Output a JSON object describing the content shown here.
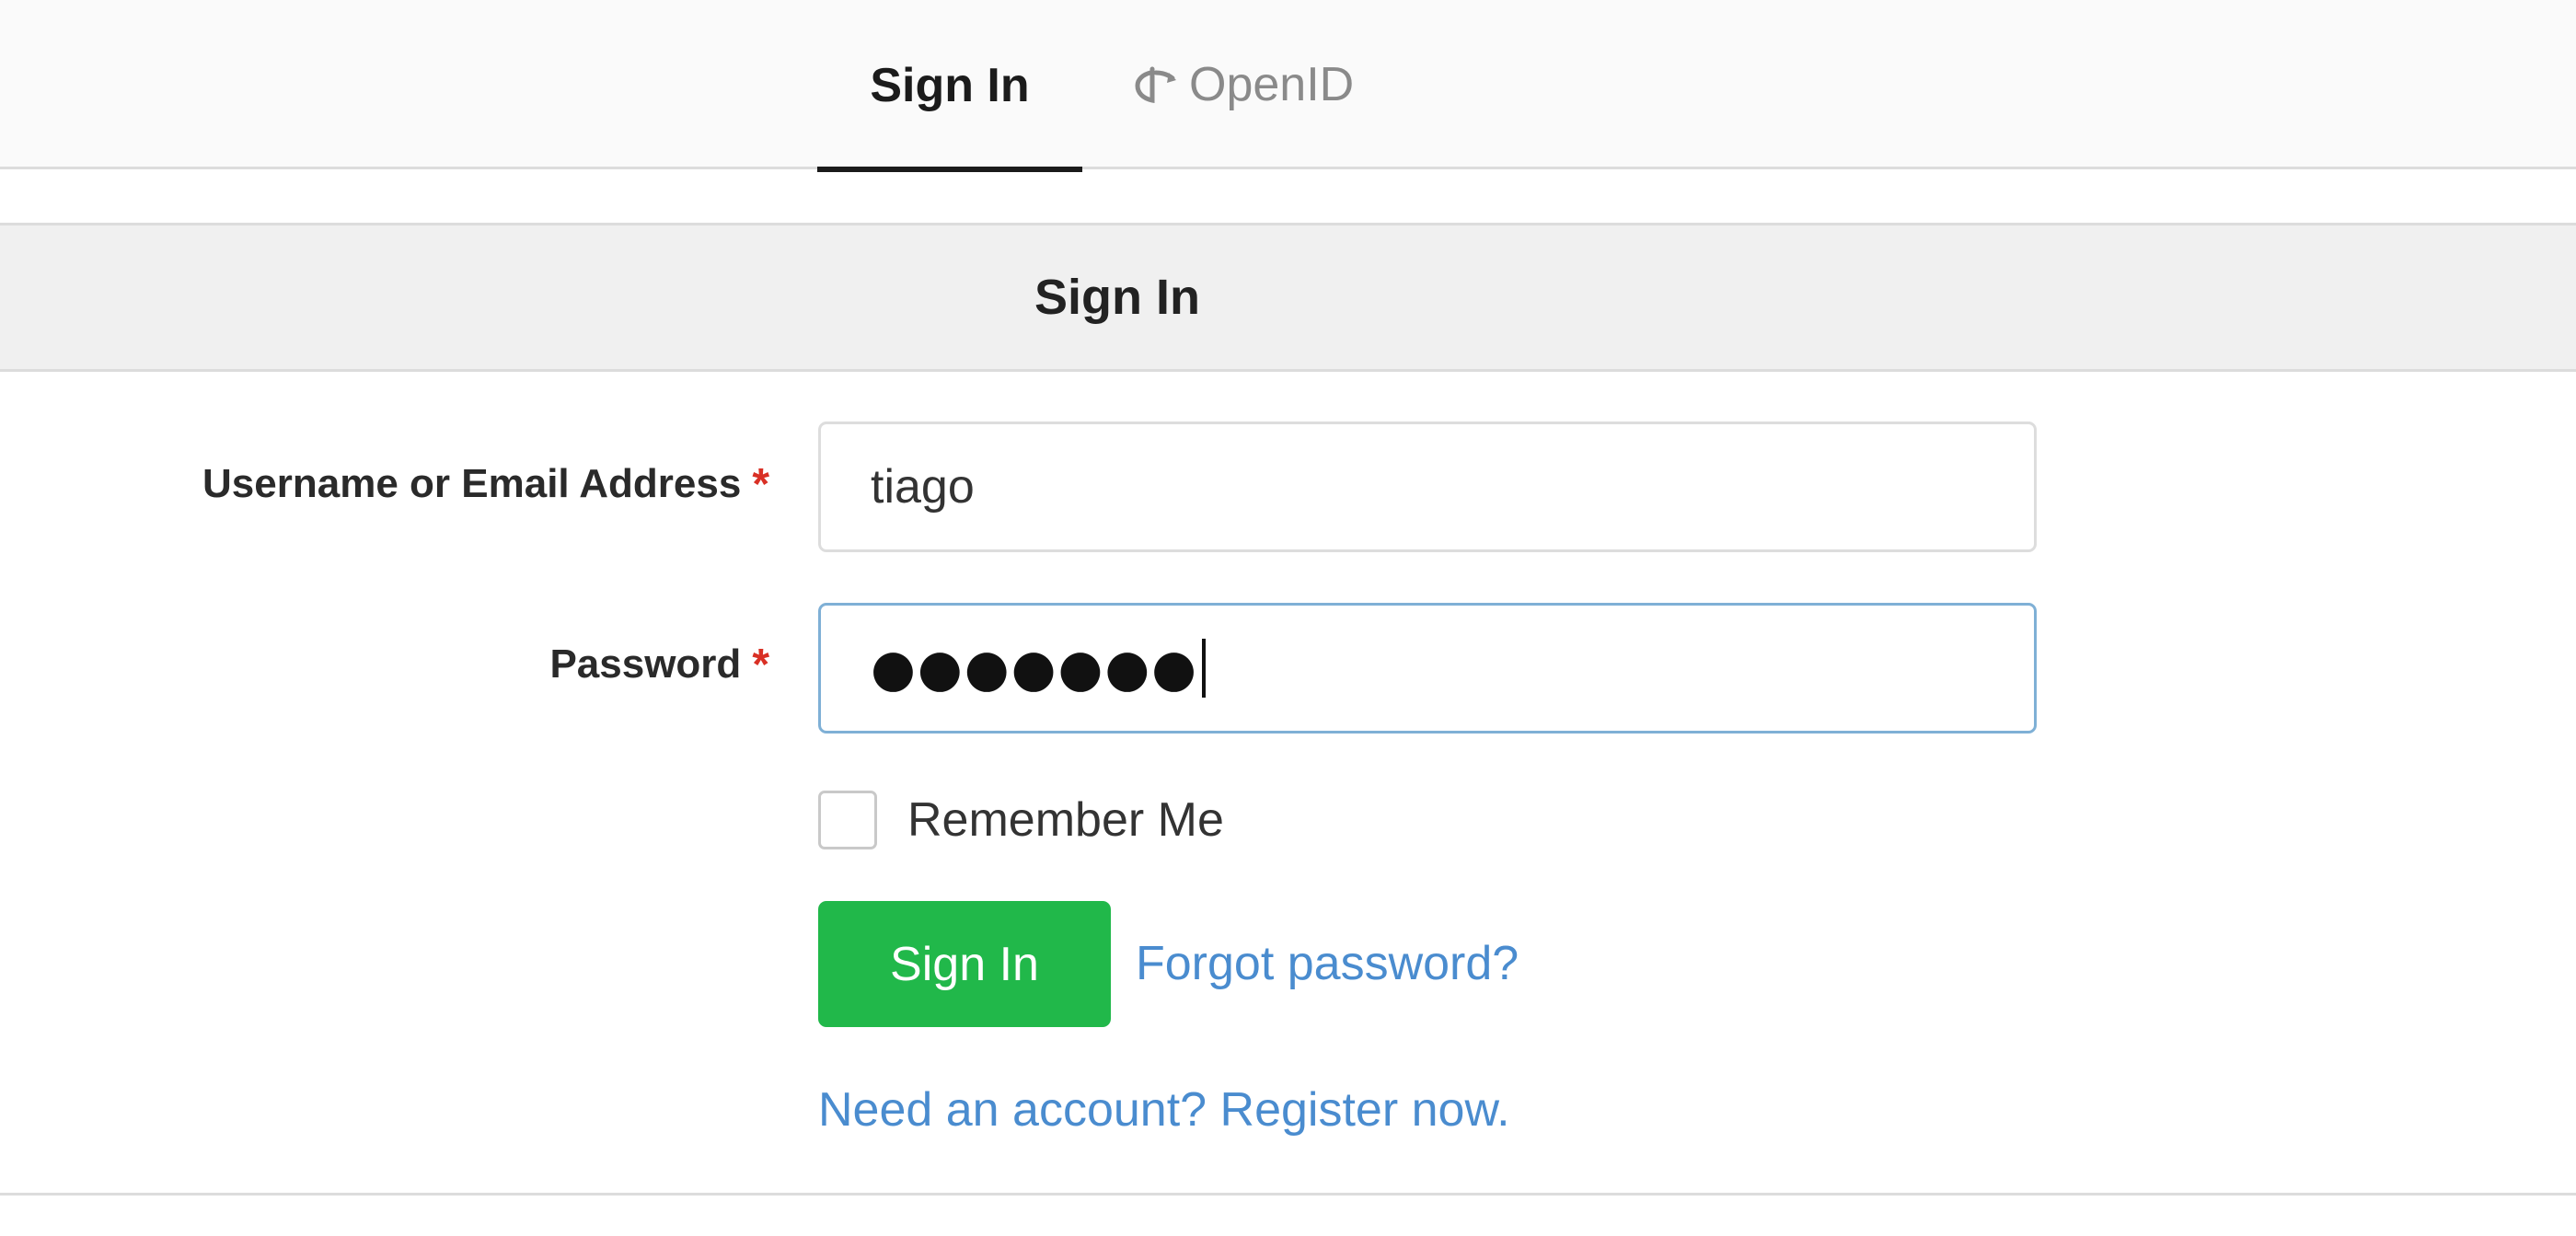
{
  "tabs": {
    "signin_label": "Sign In",
    "openid_label": "OpenID",
    "active": "Sign In"
  },
  "header": {
    "title": "Sign In"
  },
  "form": {
    "username_label": "Username or Email Address",
    "username_value": "tiago",
    "password_label": "Password",
    "password_masked": "●●●●●●●",
    "required_marker": "*",
    "remember_label": "Remember Me",
    "remember_checked": false,
    "submit_label": "Sign In",
    "forgot_label": "Forgot password?",
    "register_label": "Need an account? Register now."
  },
  "colors": {
    "primary_button": "#21b84a",
    "link": "#4a8ccf",
    "required": "#d93025",
    "focus_border": "#7fb0d6"
  },
  "icons": {
    "openid": "openid-icon"
  }
}
